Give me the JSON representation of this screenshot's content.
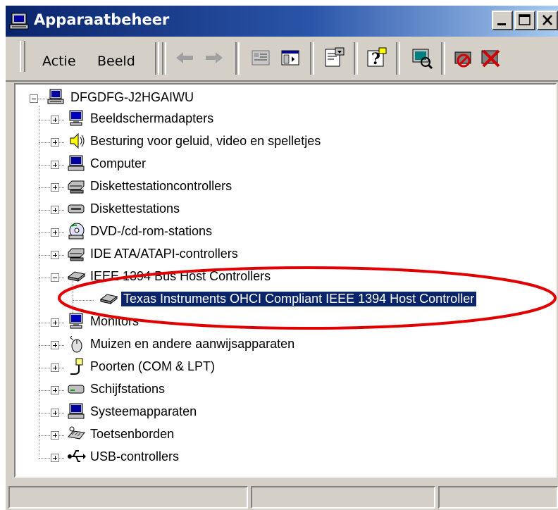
{
  "window": {
    "title": "Apparaatbeheer"
  },
  "menu": {
    "actie": "Actie",
    "beeld": "Beeld"
  },
  "tree": {
    "root": "DFGDFG-J2HGAIWU",
    "items": [
      {
        "label": "Beeldschermadapters",
        "icon": "display-adapter-icon"
      },
      {
        "label": "Besturing voor geluid, video en spelletjes",
        "icon": "speaker-icon"
      },
      {
        "label": "Computer",
        "icon": "computer-icon"
      },
      {
        "label": "Diskettestationcontrollers",
        "icon": "controller-icon"
      },
      {
        "label": "Diskettestations",
        "icon": "floppy-drive-icon"
      },
      {
        "label": "DVD-/cd-rom-stations",
        "icon": "cd-rom-icon"
      },
      {
        "label": "IDE ATA/ATAPI-controllers",
        "icon": "ide-controller-icon"
      },
      {
        "label": "IEEE 1394 Bus Host Controllers",
        "icon": "ieee1394-icon",
        "expanded": true
      },
      {
        "label": "Texas Instruments OHCI Compliant IEEE 1394 Host Controller",
        "icon": "ieee1394-device-icon",
        "child": true,
        "selected": true
      },
      {
        "label": "Monitors",
        "icon": "monitor-icon"
      },
      {
        "label": "Muizen en andere aanwijsapparaten",
        "icon": "mouse-icon"
      },
      {
        "label": "Poorten (COM & LPT)",
        "icon": "port-icon"
      },
      {
        "label": "Schijfstations",
        "icon": "disk-drive-icon"
      },
      {
        "label": "Systeemapparaten",
        "icon": "system-devices-icon"
      },
      {
        "label": "Toetsenborden",
        "icon": "keyboard-icon"
      },
      {
        "label": "USB-controllers",
        "icon": "usb-icon"
      }
    ]
  },
  "colors": {
    "selection": "#0a246a",
    "annotation": "#e00000",
    "titlebar": "#0a246a"
  }
}
